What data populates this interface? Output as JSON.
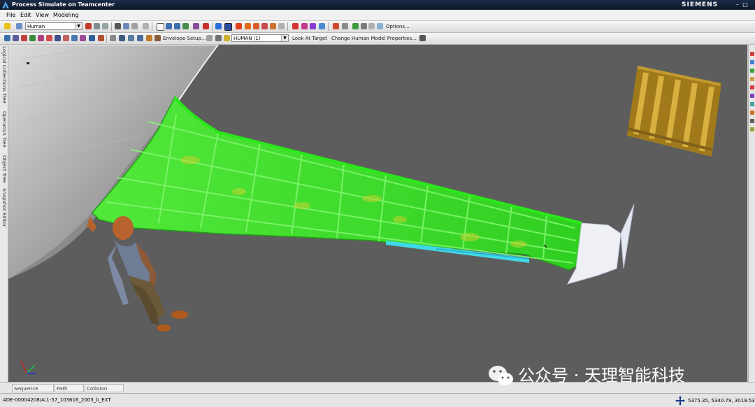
{
  "window": {
    "title": "Process Simulate on Teamcenter",
    "brand": "SIEMENS"
  },
  "menu": [
    "File",
    "Edit",
    "View",
    "Modeling"
  ],
  "toolbar1": {
    "human_combo": "Human",
    "options_label": "Options..."
  },
  "toolbar2": {
    "envelope_label": "Envelope Setup...",
    "human_combo": "HUMAN (1)",
    "look_at_label": "Look At Target",
    "change_model_label": "Change Human Model Properties..."
  },
  "left_tabs": [
    "Logical Collections Tree",
    "Operation Tree",
    "Object Tree",
    "Snapshot Editor"
  ],
  "bottom_tabs": [
    "Sequence Editor",
    "Path Editor",
    "Collision Viewer"
  ],
  "status": {
    "path": "ADE-00004208/A;1-57_103616_2003_b_EXT",
    "coords": "5375.35, 5340.79, 3019.53"
  },
  "watermark": "公众号 · 天理智能科技",
  "icons": {
    "app": "process-simulate-logo",
    "axis": "coordinate-axis-icon",
    "cursor": "move-cursor-icon",
    "wechat": "wechat-icon"
  },
  "colors": {
    "viewport_bg": "#5d5d5d",
    "wing": "#3cde2c",
    "title_bg": "#14213a"
  }
}
